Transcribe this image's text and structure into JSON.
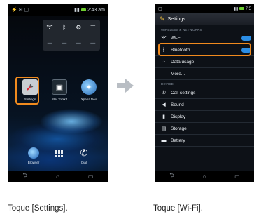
{
  "left_phone": {
    "status_time": "2:43 am",
    "apps": [
      {
        "label": "Settings",
        "icon": "settings-icon"
      },
      {
        "label": "SIM Toolkit",
        "icon": "sim-card-icon"
      },
      {
        "label": "Xperia Neo",
        "icon": "globe-icon"
      }
    ],
    "dock": [
      {
        "label": "Browser",
        "icon": "globe-icon"
      },
      {
        "label": "",
        "icon": "apps-grid-icon"
      },
      {
        "label": "Dial",
        "icon": "phone-icon"
      }
    ]
  },
  "right_phone": {
    "status_time": "7:5",
    "header_title": "Settings",
    "sections": {
      "wireless": "WIRELESS & NETWORKS",
      "device": "DEVICE"
    },
    "rows": [
      {
        "label": "Wi-Fi",
        "icon": "wifi-icon"
      },
      {
        "label": "Bluetooth",
        "icon": "bluetooth-icon"
      },
      {
        "label": "Data usage",
        "icon": "data-usage-icon"
      },
      {
        "label": "More...",
        "icon": ""
      },
      {
        "label": "Call settings",
        "icon": "phone-icon"
      },
      {
        "label": "Sound",
        "icon": "speaker-icon"
      },
      {
        "label": "Display",
        "icon": "display-icon"
      },
      {
        "label": "Storage",
        "icon": "storage-icon"
      },
      {
        "label": "Battery",
        "icon": "battery-icon"
      }
    ]
  },
  "captions": {
    "left": "Toque [Settings].",
    "right": "Toque [Wi-Fi]."
  },
  "colors": {
    "highlight": "#f08a1e",
    "toggle_on": "#2b8ee6",
    "arrow": "#b9bec4"
  }
}
